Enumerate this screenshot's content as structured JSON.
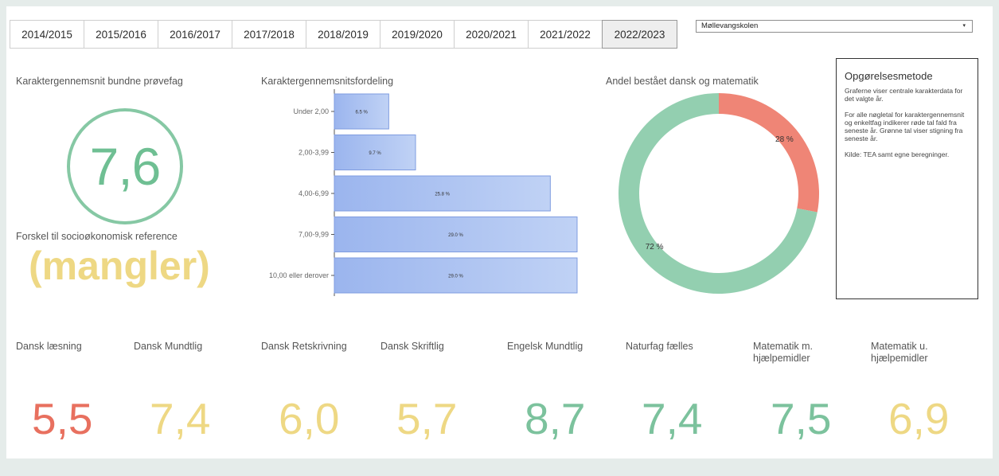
{
  "tabs": [
    "2014/2015",
    "2015/2016",
    "2016/2017",
    "2017/2018",
    "2018/2019",
    "2019/2020",
    "2020/2021",
    "2021/2022",
    "2022/2023"
  ],
  "active_tab": "2022/2023",
  "school_select": {
    "value": "Møllevangskolen",
    "arrow": "▾"
  },
  "avg": {
    "title": "Karaktergennemsnit bundne prøvefag",
    "value": "7,6"
  },
  "socio": {
    "title": "Forskel til socioøkonomisk reference",
    "value": "(mangler)"
  },
  "distribution": {
    "title": "Karaktergennemsnitsfordeling"
  },
  "pass": {
    "title": "Andel bestået dansk og matematik"
  },
  "info": {
    "heading": "Opgørelsesmetode",
    "p1": "Graferne viser centrale karakterdata for det valgte år.",
    "p2": "For alle nøgletal for karaktergennemsnit og enkeltfag indikerer røde tal fald fra seneste år. Grønne tal viser stigning fra seneste år.",
    "p3": "Kilde: TEA samt egne beregninger."
  },
  "subjects": [
    {
      "label": "Dansk læsning",
      "value": "5,5",
      "color": "#e8705f"
    },
    {
      "label": "Dansk Mundtlig",
      "value": "7,4",
      "color": "#eed884"
    },
    {
      "label": "Dansk Retskrivning",
      "value": "6,0",
      "color": "#eed884"
    },
    {
      "label": "Dansk Skriftlig",
      "value": "5,7",
      "color": "#eed884"
    },
    {
      "label": "Engelsk Mundtlig",
      "value": "8,7",
      "color": "#7cc29d"
    },
    {
      "label": "Naturfag fælles",
      "value": "7,4",
      "color": "#7cc29d"
    },
    {
      "label": "Matematik m. hjælpemidler",
      "value": "7,5",
      "color": "#7cc29d"
    },
    {
      "label": "Matematik u. hjælpemidler",
      "value": "6,9",
      "color": "#eed884"
    }
  ],
  "colors": {
    "green": "#7cc29d",
    "red": "#ef8576",
    "yellow": "#eed884",
    "bar": "#a7bff0"
  },
  "chart_data": [
    {
      "type": "bar",
      "orientation": "horizontal",
      "title": "Karaktergennemsnitsfordeling",
      "categories": [
        "Under 2,00",
        "2,00-3,99",
        "4,00-6,99",
        "7,00-9,99",
        "10,00 eller derover"
      ],
      "values": [
        6.5,
        9.7,
        25.8,
        29.0,
        29.0
      ],
      "labels": [
        "6.5 %",
        "9.7 %",
        "25.8 %",
        "29.0 %",
        "29.0 %"
      ]
    },
    {
      "type": "pie",
      "donut": true,
      "title": "Andel bestået dansk og matematik",
      "values": [
        28,
        72
      ],
      "labels": [
        "28 %",
        "72 %"
      ],
      "colors": [
        "#ef8576",
        "#93cfb0"
      ]
    }
  ]
}
